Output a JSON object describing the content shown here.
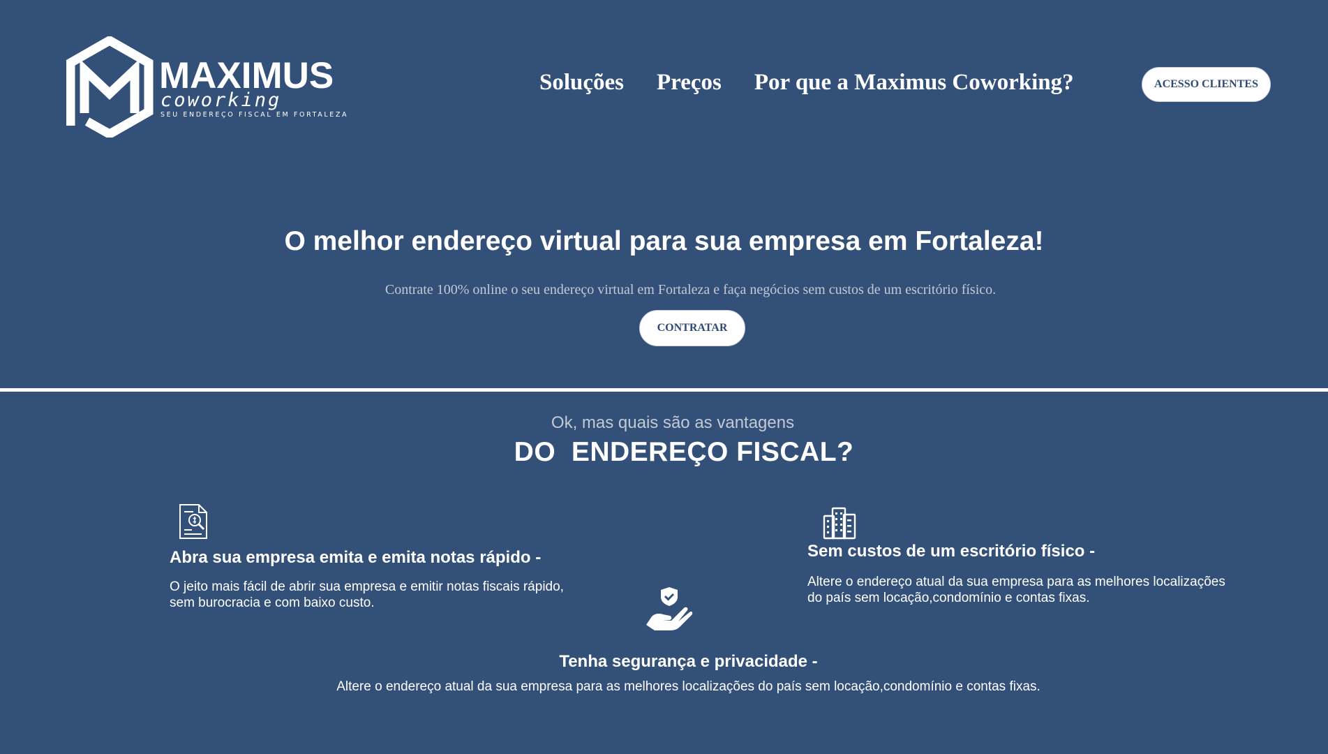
{
  "header": {
    "brand_name": "MAXIMUS",
    "brand_sub": "coworking",
    "brand_tagline": "SEU ENDEREÇO FISCAL EM FORTALEZA",
    "nav": [
      "Soluções",
      "Preços",
      "Por que a Maximus Coworking?"
    ],
    "access_button": "ACESSO CLIENTES"
  },
  "hero": {
    "title": "O melhor endereço virtual para sua empresa em Fortaleza!",
    "subtitle": "Contrate 100% online o seu endereço virtual em Fortaleza e faça negócios sem custos de um escritório físico.",
    "cta": "CONTRATAR"
  },
  "advantages": {
    "pre_title": "Ok, mas quais são as vantagens",
    "title": "DO  ENDEREÇO FISCAL?",
    "features": [
      {
        "icon": "document-search-icon",
        "title": "Abra sua empresa emita e emita notas rápido -",
        "body": "O jeito mais fácil de abrir sua empresa e emitir notas fiscais rápido, sem burocracia e com baixo custo."
      },
      {
        "icon": "building-icon",
        "title": "Sem custos de um escritório físico -",
        "body": "Altere o endereço atual da sua empresa para as melhores localizações do país sem locação,condomínio e contas fixas."
      },
      {
        "icon": "hand-shield-icon",
        "title": "Tenha segurança e privacidade -",
        "body": "Altere o endereço atual da sua empresa para as melhores localizações do país sem locação,condomínio e contas fixas."
      }
    ]
  },
  "colors": {
    "background": "#335078",
    "text": "#ffffff",
    "muted_text": "#c3cad5",
    "button_bg": "#ffffff",
    "button_text": "#2f4a73"
  }
}
